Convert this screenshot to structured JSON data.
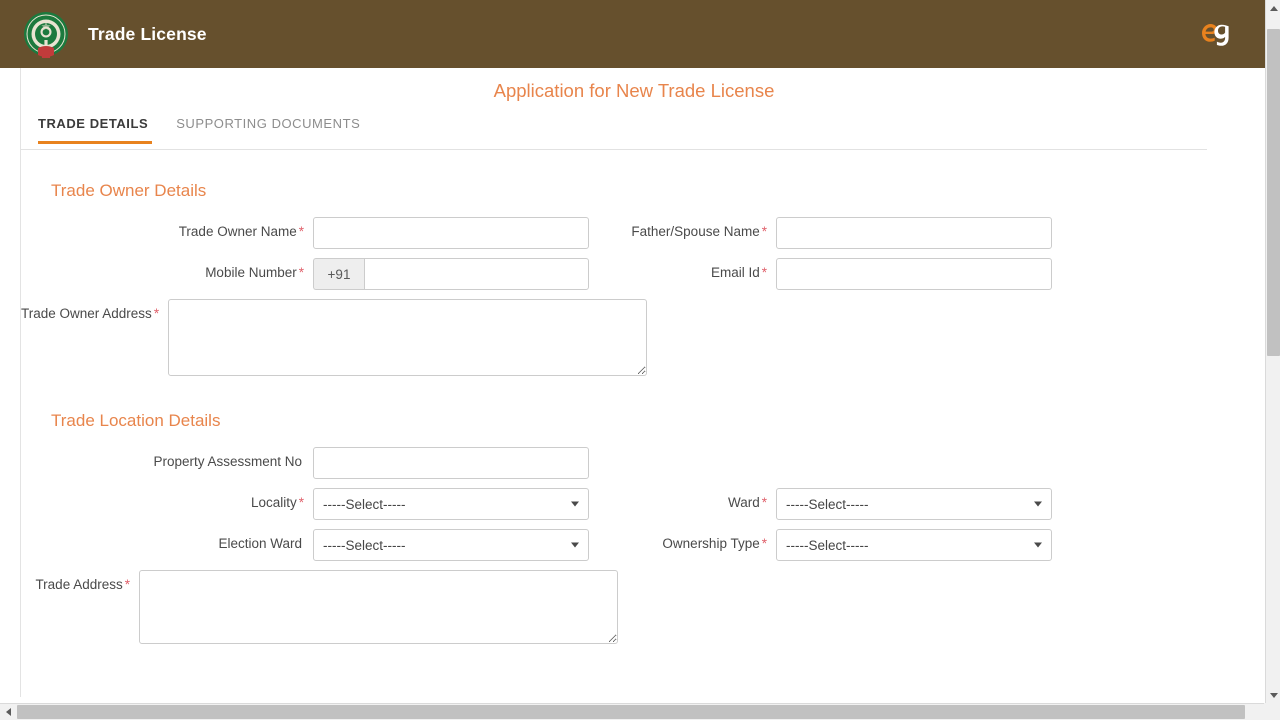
{
  "header": {
    "app_title": "Trade License",
    "emblem_icon": "ap-government-emblem-icon",
    "brand_icon": "e9-logo-icon",
    "background_color": "#66502D"
  },
  "page": {
    "title": "Application for New Trade License",
    "title_color": "#E8854C"
  },
  "tabs": {
    "accent_color": "#E8821E",
    "items": [
      {
        "label": "TRADE DETAILS",
        "active": true
      },
      {
        "label": "SUPPORTING DOCUMENTS",
        "active": false
      }
    ]
  },
  "sections": {
    "owner": {
      "heading": "Trade Owner Details",
      "fields": {
        "trade_owner_name": {
          "label": "Trade Owner Name",
          "required": "*",
          "value": "",
          "placeholder": ""
        },
        "father_spouse_name": {
          "label": "Father/Spouse Name",
          "required": "*",
          "value": "",
          "placeholder": ""
        },
        "mobile_number": {
          "label": "Mobile Number",
          "required": "*",
          "prefix": "+91",
          "value": "",
          "placeholder": ""
        },
        "email_id": {
          "label": "Email Id",
          "required": "*",
          "value": "",
          "placeholder": ""
        },
        "trade_owner_address": {
          "label": "Trade Owner Address",
          "required": "*",
          "value": "",
          "placeholder": ""
        }
      }
    },
    "location": {
      "heading": "Trade Location Details",
      "fields": {
        "property_assessment_no": {
          "label": "Property Assessment No",
          "required": "",
          "value": "",
          "placeholder": ""
        },
        "locality": {
          "label": "Locality",
          "required": "*",
          "selected": "-----Select-----"
        },
        "ward": {
          "label": "Ward",
          "required": "*",
          "selected": "-----Select-----"
        },
        "election_ward": {
          "label": "Election Ward",
          "required": "",
          "selected": "-----Select-----"
        },
        "ownership_type": {
          "label": "Ownership Type",
          "required": "*",
          "selected": "-----Select-----"
        },
        "trade_address": {
          "label": "Trade Address",
          "required": "*",
          "value": "",
          "placeholder": ""
        }
      }
    }
  },
  "scrollbars": {
    "vertical_icon_up": "scroll-up-arrow-icon",
    "vertical_icon_down": "scroll-down-arrow-icon",
    "horizontal_icon_left": "scroll-left-arrow-icon",
    "horizontal_icon_right": "scroll-right-arrow-icon"
  }
}
